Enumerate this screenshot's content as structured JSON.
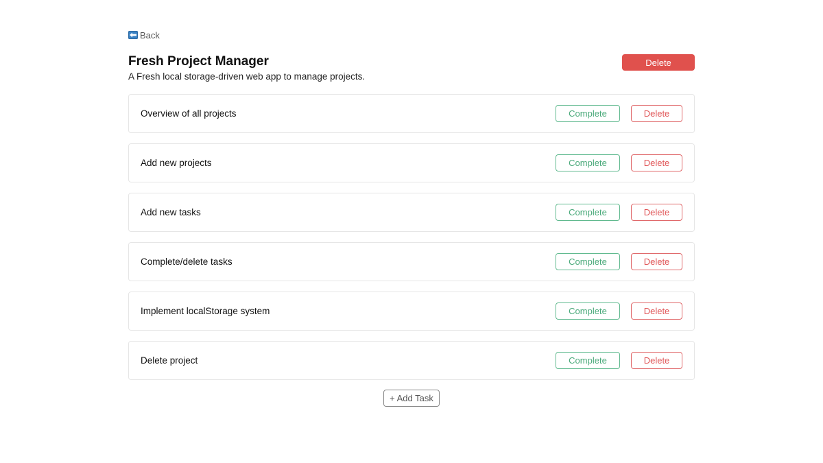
{
  "nav": {
    "back_label": "Back",
    "back_icon": "back-arrow-icon"
  },
  "project": {
    "title": "Fresh Project Manager",
    "description": "A Fresh local storage-driven web app to manage projects.",
    "delete_label": "Delete"
  },
  "tasks": [
    {
      "name": "Overview of all projects",
      "complete_label": "Complete",
      "delete_label": "Delete"
    },
    {
      "name": "Add new projects",
      "complete_label": "Complete",
      "delete_label": "Delete"
    },
    {
      "name": "Add new tasks",
      "complete_label": "Complete",
      "delete_label": "Delete"
    },
    {
      "name": "Complete/delete tasks",
      "complete_label": "Complete",
      "delete_label": "Delete"
    },
    {
      "name": "Implement localStorage system",
      "complete_label": "Complete",
      "delete_label": "Delete"
    },
    {
      "name": "Delete project",
      "complete_label": "Complete",
      "delete_label": "Delete"
    }
  ],
  "actions": {
    "add_task_label": "+ Add Task"
  },
  "colors": {
    "danger": "#e0514d",
    "success": "#4aa97a",
    "border": "#e6e6e6"
  }
}
